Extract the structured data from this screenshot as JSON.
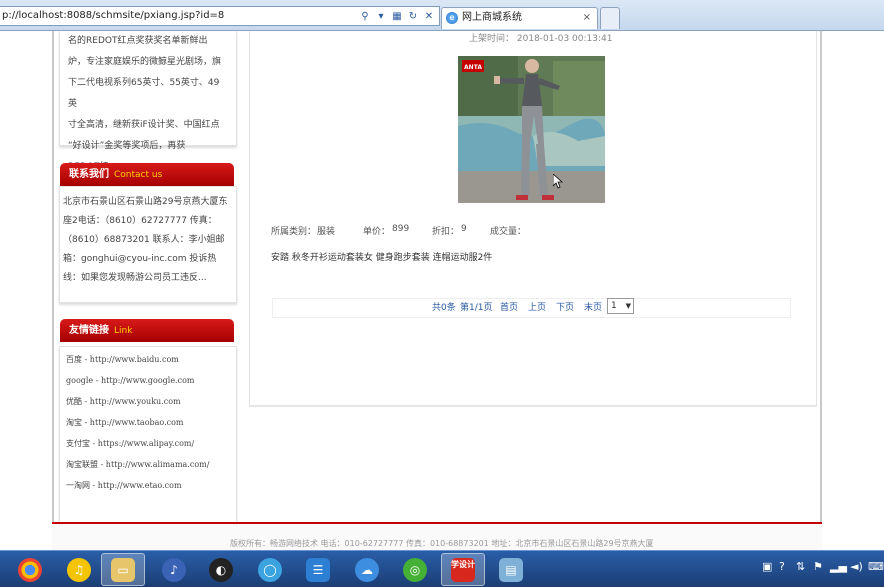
{
  "browser": {
    "address": "p://localhost:8088/schmsite/pxiang.jsp?id=8",
    "tab_title": "网上商城系统",
    "tab_close": "×",
    "addr_icons": [
      "search-icon",
      "dropdown-icon",
      "compat-icon",
      "refresh-icon",
      "close-icon"
    ]
  },
  "sidebar": {
    "intro_lines": [
      "名的REDOT红点奖获奖名单新鲜出",
      "炉，专注家庭娱乐的微鲸星光剧场，旗",
      "下二代电视系列65英寸、55英寸、49英",
      "寸全高清，继新获iF设计奖、中国红点",
      "“好设计”金奖等奖项后，再获",
      "REDOT红..."
    ],
    "contact_title": "联系我们",
    "contact_en": "Contact us",
    "contact_text": "北京市石景山区石景山路29号京燕大厦东座2电话：（8610）62727777 传真：（8610）68873201 联系人：李小姐邮箱：gonghui@cyou-inc.com 投诉热线：如果您发现畅游公司员工违反...",
    "links_title": "友情链接",
    "links_en": "Link",
    "links": [
      "百度  - http://www.baidu.com",
      "google  - http://www.google.com",
      "优酷  - http://www.youku.com",
      "淘宝  - http://www.taobao.com",
      "支付宝  - https://www.alipay.com/",
      "淘宝联盟  - http://www.alimama.com/",
      "一淘网  - http://www.etao.com"
    ]
  },
  "product": {
    "pub_label": "上架时间：",
    "pub_time": "2018-01-03 00:13:41",
    "category_label": "所属类别：",
    "category": "服装",
    "price_label": "单价：",
    "price": "899",
    "discount_label": "折扣：",
    "discount": "9",
    "deal_label": "成交量：",
    "deal": "",
    "name": "安踏 秋冬开衫运动套装女 健身跑步套装 连帽运动服2件",
    "brand_logo": "ANTA"
  },
  "pager": {
    "total": "共0条",
    "page": "第1/1页",
    "first": "首页",
    "prev": "上页",
    "next": "下页",
    "last": "末页",
    "selected": "1"
  },
  "footer": {
    "text": "版权所有：畅游网络技术  电话：010-62727777  传真：010-68873201  地址：北京市石景山区石景山路29号京燕大厦"
  },
  "taskbar": {
    "apps": [
      "chrome-icon",
      "music-icon",
      "explorer-icon",
      "itunes-icon",
      "qq-icon",
      "browser-icon",
      "app-grid-icon",
      "baidu-cloud-icon",
      "360-icon",
      "design-icon",
      "notes-icon"
    ],
    "app_labels": {
      "design": "学设计"
    },
    "tray_icons": [
      "network-icon",
      "help-icon",
      "usb-icon",
      "flag-icon",
      "signal-icon",
      "volume-icon",
      "keyboard-icon"
    ]
  },
  "colors": {
    "accent_red": "#c40000",
    "link_blue": "#2a5aa0"
  }
}
